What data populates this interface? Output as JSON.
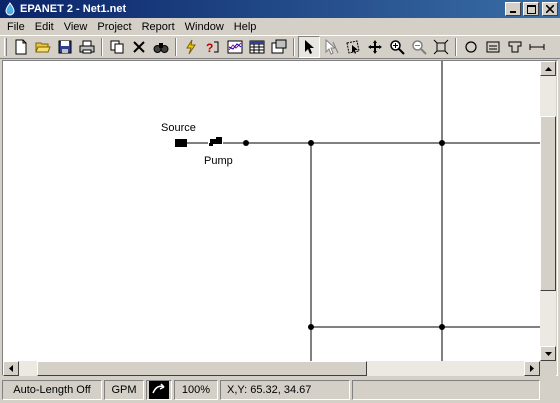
{
  "window": {
    "title": "EPANET 2 - Net1.net",
    "controls": [
      "minimize-icon",
      "maximize-icon",
      "close-icon"
    ]
  },
  "menu": {
    "items": [
      {
        "label": "File"
      },
      {
        "label": "Edit"
      },
      {
        "label": "View"
      },
      {
        "label": "Project"
      },
      {
        "label": "Report"
      },
      {
        "label": "Window"
      },
      {
        "label": "Help"
      }
    ]
  },
  "toolbar": {
    "buttons": [
      "new-icon",
      "open-icon",
      "save-icon",
      "print-icon",
      "copy-icon",
      "delete-icon",
      "find-icon",
      "run-icon",
      "query-icon",
      "graph-icon",
      "table-icon",
      "options-icon",
      "select-object-icon",
      "select-vertex-icon",
      "select-region-icon",
      "pan-icon",
      "zoom-in-icon",
      "zoom-out-icon",
      "full-extent-icon",
      "add-junction-icon",
      "add-reservoir-icon",
      "add-tank-icon",
      "add-pipe-icon"
    ],
    "pressed": "select-object-icon"
  },
  "map": {
    "labels": {
      "source": "Source",
      "pump": "Pump"
    }
  },
  "status": {
    "auto_length": "Auto-Length Off",
    "flow_units": "GPM",
    "zoom": "100%",
    "xy": "X,Y: 65.32, 34.67"
  }
}
